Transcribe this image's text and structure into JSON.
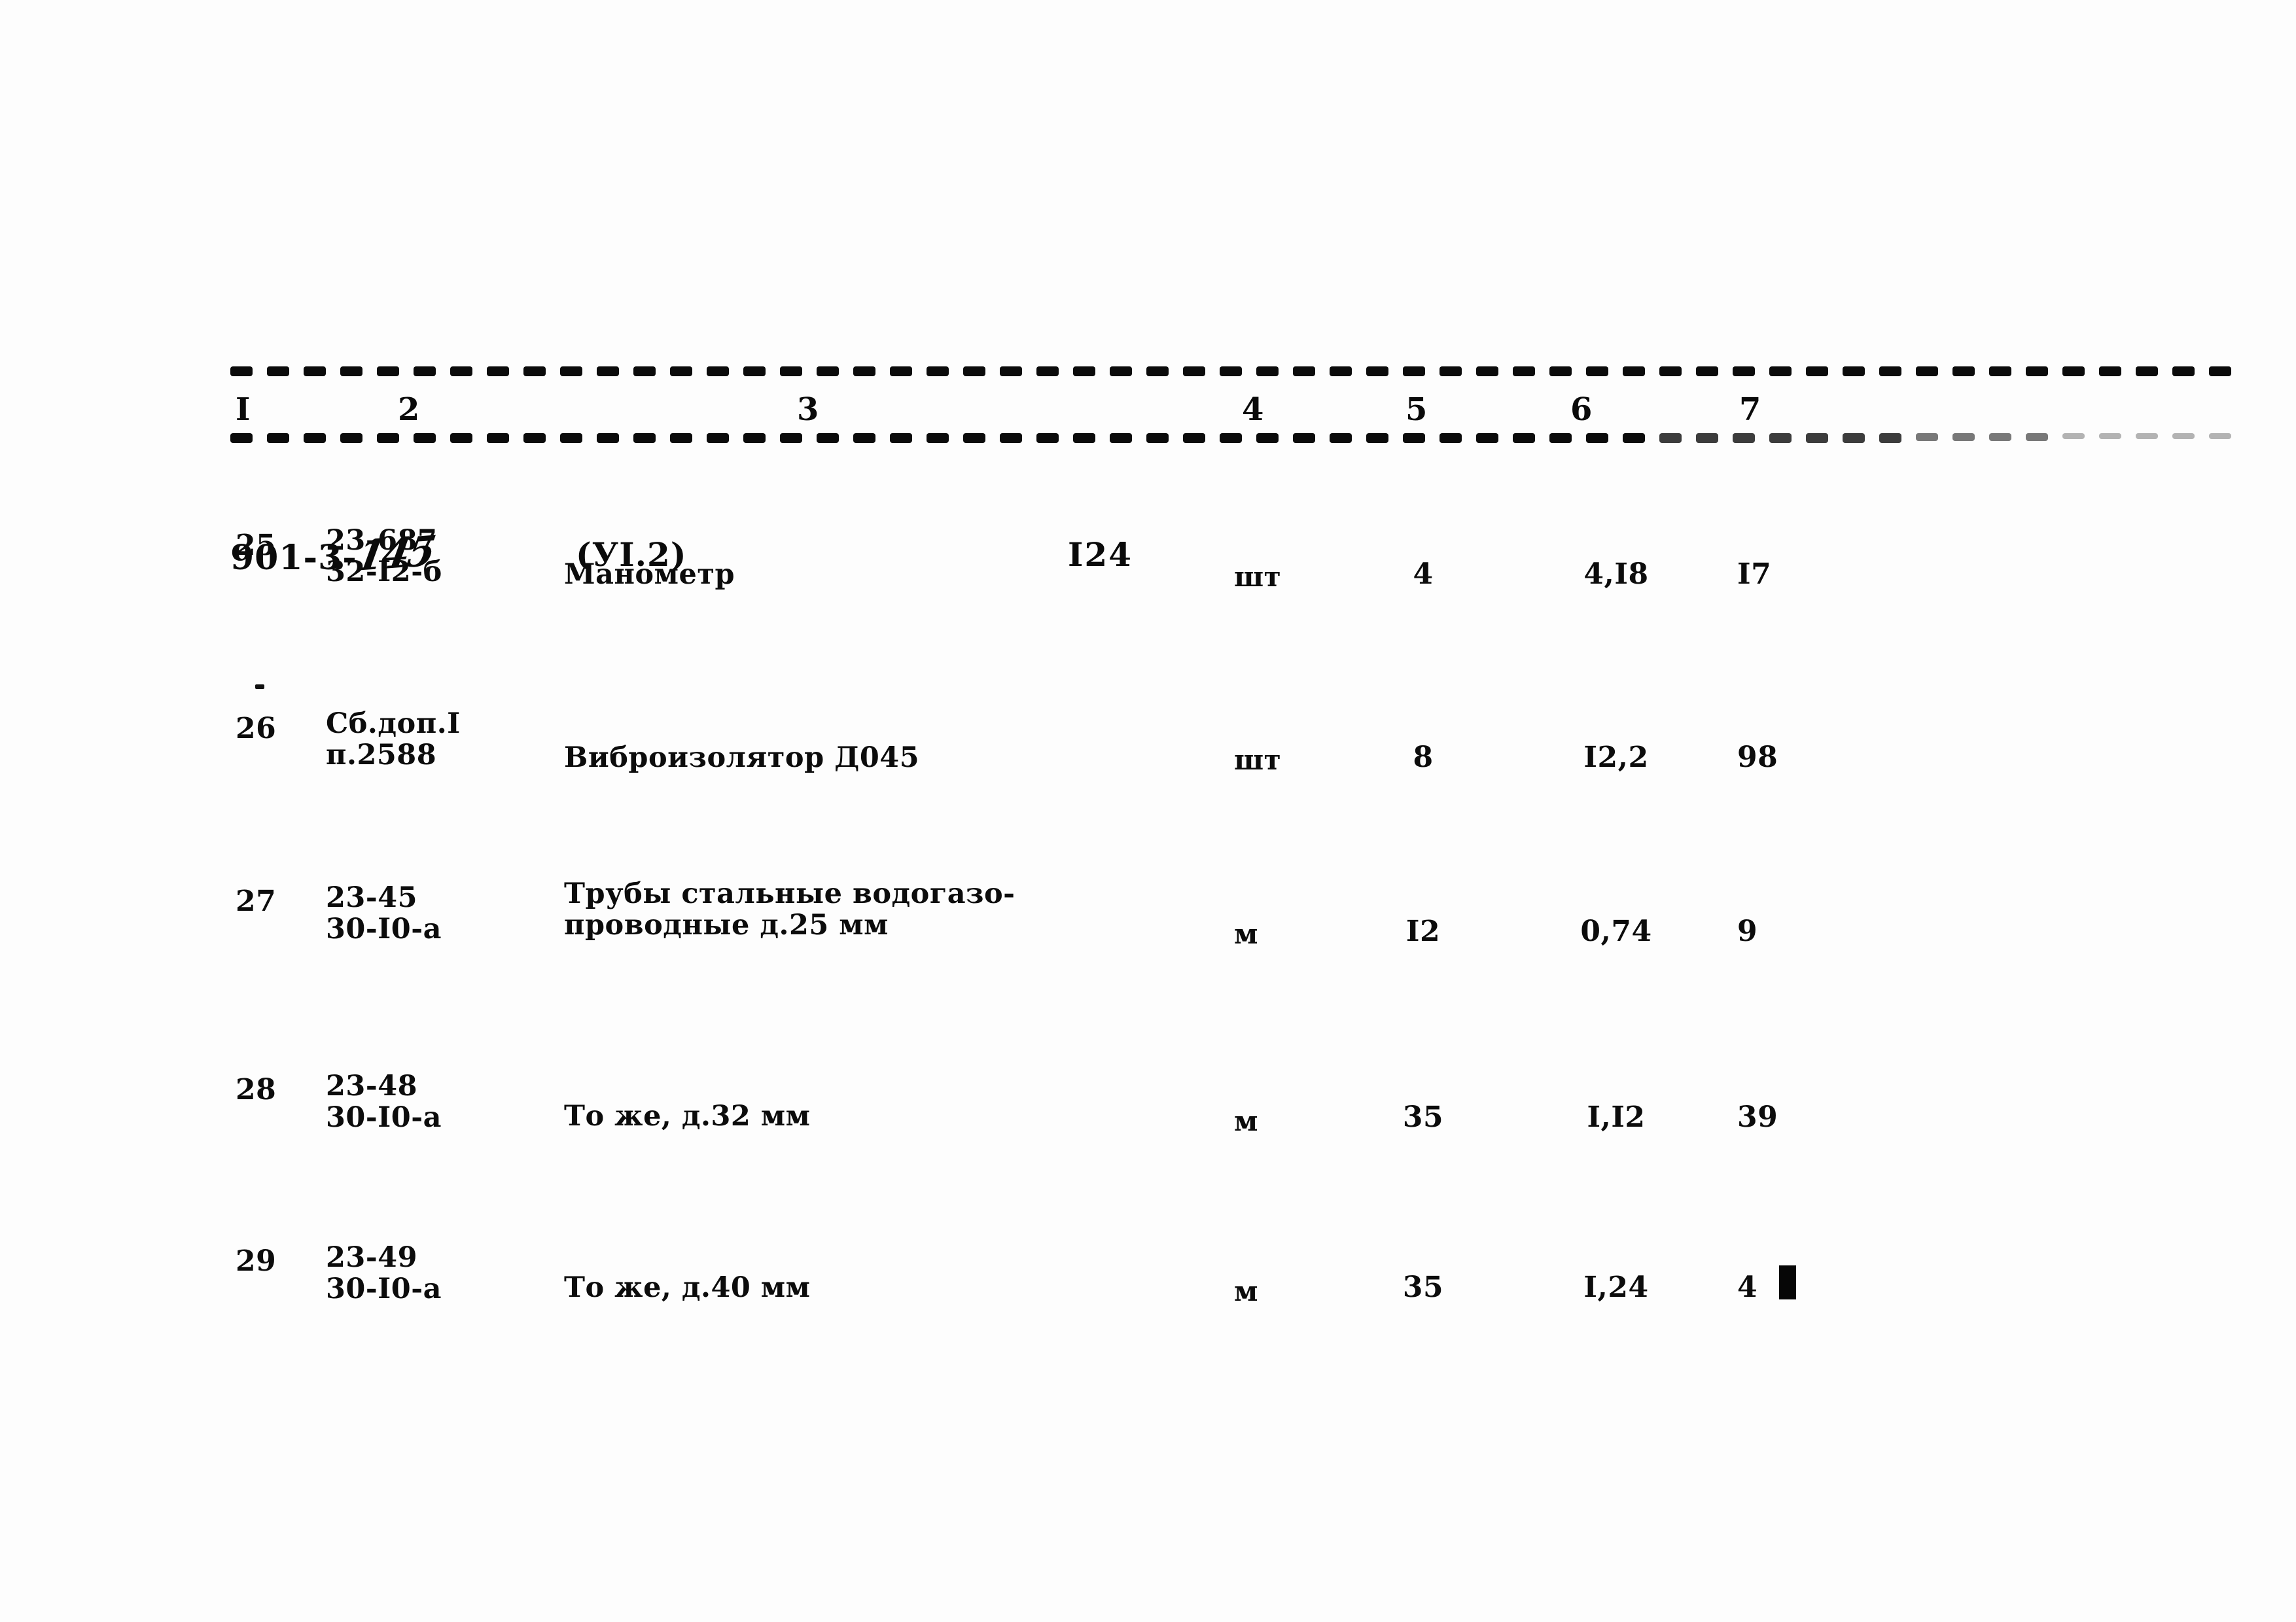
{
  "document": {
    "series_code": "901-3-",
    "series_handwritten": "145",
    "section": "(УI.2)",
    "page_number": "I24"
  },
  "table": {
    "column_headers": [
      "I",
      "2",
      "3",
      "4",
      "5",
      "6",
      "7"
    ],
    "rows": [
      {
        "num": "25",
        "code_line1": "23-687",
        "code_line2": "32-I2-б",
        "name_line1": "Манометр",
        "name_line2": "",
        "unit": "шт",
        "quantity": "4",
        "price": "4,I8",
        "total": "I7"
      },
      {
        "num": "26",
        "code_line1": "Сб.доп.I",
        "code_line2": "п.2588",
        "name_line1": "Виброизолятор Д045",
        "name_line2": "",
        "unit": "шт",
        "quantity": "8",
        "price": "I2,2",
        "total": "98"
      },
      {
        "num": "27",
        "code_line1": "23-45",
        "code_line2": "30-I0-а",
        "name_line1": "Трубы стальные водогазо-",
        "name_line2": "проводные д.25 мм",
        "unit": "м",
        "quantity": "I2",
        "price": "0,74",
        "total": "9"
      },
      {
        "num": "28",
        "code_line1": "23-48",
        "code_line2": "30-I0-а",
        "name_line1": "",
        "name_line2": "То же, д.32 мм",
        "unit": "м",
        "quantity": "35",
        "price": "I,I2",
        "total": "39"
      },
      {
        "num": "29",
        "code_line1": "23-49",
        "code_line2": "30-I0-а",
        "name_line1": "",
        "name_line2": "То же, д.40 мм",
        "unit": "м",
        "quantity": "35",
        "price": "I,24",
        "total": "4"
      }
    ]
  }
}
